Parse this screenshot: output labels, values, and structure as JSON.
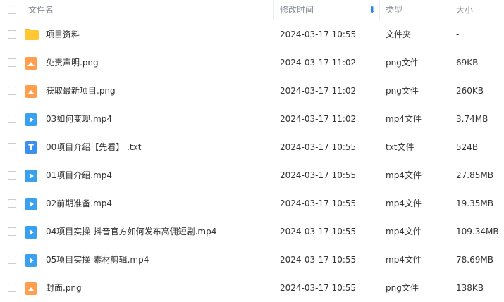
{
  "header": {
    "name": "文件名",
    "modified": "修改时间",
    "sort_arrow": "⬇",
    "type": "类型",
    "size": "大小"
  },
  "rows": [
    {
      "icon": "folder-icon",
      "name": "项目资料",
      "modified": "2024-03-17 10:55",
      "type": "文件夹",
      "size": "-"
    },
    {
      "icon": "image-file-icon",
      "name": "免责声明.png",
      "modified": "2024-03-17 11:02",
      "type": "png文件",
      "size": "69KB"
    },
    {
      "icon": "image-file-icon",
      "name": "获取最新项目.png",
      "modified": "2024-03-17 11:02",
      "type": "png文件",
      "size": "260KB"
    },
    {
      "icon": "video-file-icon",
      "name": "03如何变现.mp4",
      "modified": "2024-03-17 11:02",
      "type": "mp4文件",
      "size": "3.74MB"
    },
    {
      "icon": "text-file-icon",
      "name": "00项目介绍【先看】 .txt",
      "modified": "2024-03-17 10:55",
      "type": "txt文件",
      "size": "524B"
    },
    {
      "icon": "video-file-icon",
      "name": "01项目介绍.mp4",
      "modified": "2024-03-17 10:55",
      "type": "mp4文件",
      "size": "27.85MB"
    },
    {
      "icon": "video-file-icon",
      "name": "02前期准备.mp4",
      "modified": "2024-03-17 10:55",
      "type": "mp4文件",
      "size": "19.35MB"
    },
    {
      "icon": "video-file-icon",
      "name": "04项目实操-抖音官方如何发布高佣短剧.mp4",
      "modified": "2024-03-17 10:55",
      "type": "mp4文件",
      "size": "109.34MB"
    },
    {
      "icon": "video-file-icon",
      "name": "05项目实操-素材剪辑.mp4",
      "modified": "2024-03-17 10:55",
      "type": "mp4文件",
      "size": "78.69MB"
    },
    {
      "icon": "image-file-icon",
      "name": "封面.png",
      "modified": "2024-03-17 10:55",
      "type": "png文件",
      "size": "138KB"
    }
  ],
  "txt_icon_letter": "T",
  "colors": {
    "folder": "#ffc731",
    "png": "#ff9e4d",
    "mp4": "#3aa0f0",
    "txt": "#3a8ff0",
    "sort_accent": "#2f80ed"
  }
}
